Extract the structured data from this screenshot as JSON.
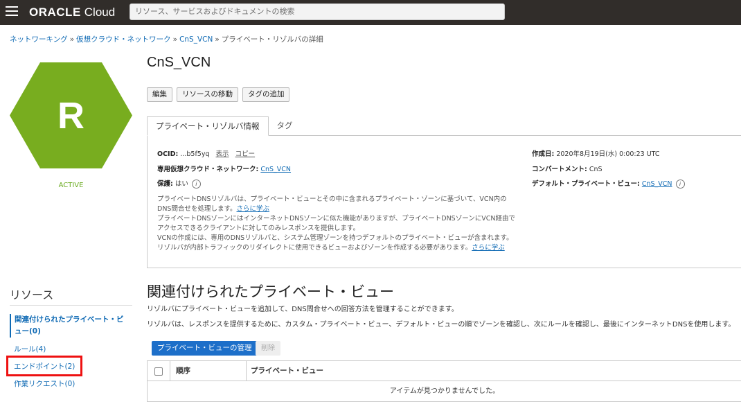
{
  "header": {
    "brand_oracle": "ORACLE",
    "brand_cloud": "Cloud",
    "search_placeholder": "リソース、サービスおよびドキュメントの検索"
  },
  "breadcrumb": {
    "items": [
      "ネットワーキング",
      "仮想クラウド・ネットワーク",
      "CnS_VCN"
    ],
    "separator": "»",
    "current": "プライベート・リゾルバの詳細"
  },
  "resource_icon": {
    "letter": "R",
    "color": "#78ad1f",
    "status": "ACTIVE"
  },
  "page_title": "CnS_VCN",
  "actions": [
    "編集",
    "リソースの移動",
    "タグの追加"
  ],
  "tabs": [
    "プライベート・リゾルバ情報",
    "タグ"
  ],
  "info": {
    "ocid_label": "OCID:",
    "ocid_value": "...b5f5yq",
    "show": "表示",
    "copy": "コピー",
    "vcn_label": "専用仮想クラウド・ネットワーク:",
    "vcn_value": "CnS_VCN",
    "protect_label": "保護:",
    "protect_value": "はい",
    "created_label": "作成日:",
    "created_value": "2020年8月19日(水) 0:00:23 UTC",
    "compartment_label": "コンパートメント:",
    "compartment_value": "CnS",
    "default_view_label": "デフォルト・プライベート・ビュー:",
    "default_view_value": "CnS_VCN",
    "desc_1": "プライベートDNSリゾルバは、プライベート・ビューとその中に含まれるプライベート・ゾーンに基づいて、VCN内の",
    "desc_2": "DNS問合せを処理します。",
    "learn_more": "さらに学ぶ",
    "desc_3": "プライベートDNSゾーンにはインターネットDNSゾーンに似た機能がありますが、プライベートDNSゾーンにVCN経由で",
    "desc_4": "アクセスできるクライアントに対してのみレスポンスを提供します。",
    "desc_5": "VCNの作成には、専用のDNSリゾルバと、システム管理ゾーンを持つデフォルトのプライベート・ビューが含まれます。",
    "desc_6": "リゾルバが内部トラフィックのリダイレクトに使用できるビューおよびゾーンを作成する必要があります。"
  },
  "resources": {
    "title": "リソース",
    "active_line1": "関連付けられたプライベート・ビ",
    "active_line2": "ュー(0)",
    "rules": "ルール(4)",
    "endpoints": "エンドポイント(2)",
    "work_requests": "作業リクエスト(0)"
  },
  "section": {
    "title": "関連付けられたプライベート・ビュー",
    "desc1": "リゾルバにプライベート・ビューを追加して、DNS問合せへの回答方法を管理することができます。",
    "desc2": "リゾルバは、レスポンスを提供するために、カスタム・プライベート・ビュー、デフォルト・ビューの順でゾーンを確認し、次にルールを確認し、最後にインターネットDNSを使用します。",
    "manage_button": "プライベート・ビューの管理",
    "delete_button": "削除",
    "col_order": "順序",
    "col_view": "プライベート・ビュー",
    "empty": "アイテムが見つかりませんでした。"
  }
}
